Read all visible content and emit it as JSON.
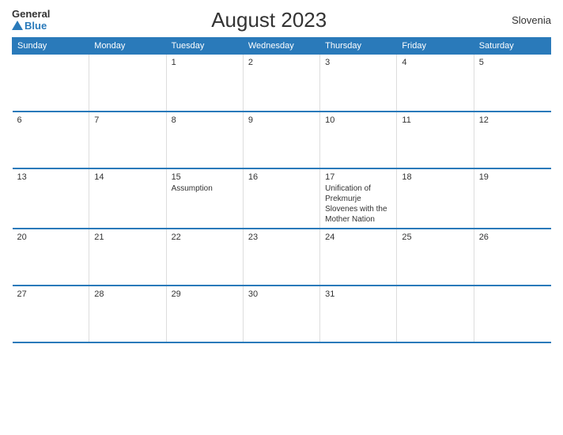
{
  "header": {
    "logo_general": "General",
    "logo_blue": "Blue",
    "title": "August 2023",
    "country": "Slovenia"
  },
  "days": [
    "Sunday",
    "Monday",
    "Tuesday",
    "Wednesday",
    "Thursday",
    "Friday",
    "Saturday"
  ],
  "weeks": [
    [
      {
        "date": "",
        "event": ""
      },
      {
        "date": "",
        "event": ""
      },
      {
        "date": "1",
        "event": ""
      },
      {
        "date": "2",
        "event": ""
      },
      {
        "date": "3",
        "event": ""
      },
      {
        "date": "4",
        "event": ""
      },
      {
        "date": "5",
        "event": ""
      }
    ],
    [
      {
        "date": "6",
        "event": ""
      },
      {
        "date": "7",
        "event": ""
      },
      {
        "date": "8",
        "event": ""
      },
      {
        "date": "9",
        "event": ""
      },
      {
        "date": "10",
        "event": ""
      },
      {
        "date": "11",
        "event": ""
      },
      {
        "date": "12",
        "event": ""
      }
    ],
    [
      {
        "date": "13",
        "event": ""
      },
      {
        "date": "14",
        "event": ""
      },
      {
        "date": "15",
        "event": "Assumption"
      },
      {
        "date": "16",
        "event": ""
      },
      {
        "date": "17",
        "event": "Unification of Prekmurje Slovenes with the Mother Nation"
      },
      {
        "date": "18",
        "event": ""
      },
      {
        "date": "19",
        "event": ""
      }
    ],
    [
      {
        "date": "20",
        "event": ""
      },
      {
        "date": "21",
        "event": ""
      },
      {
        "date": "22",
        "event": ""
      },
      {
        "date": "23",
        "event": ""
      },
      {
        "date": "24",
        "event": ""
      },
      {
        "date": "25",
        "event": ""
      },
      {
        "date": "26",
        "event": ""
      }
    ],
    [
      {
        "date": "27",
        "event": ""
      },
      {
        "date": "28",
        "event": ""
      },
      {
        "date": "29",
        "event": ""
      },
      {
        "date": "30",
        "event": ""
      },
      {
        "date": "31",
        "event": ""
      },
      {
        "date": "",
        "event": ""
      },
      {
        "date": "",
        "event": ""
      }
    ]
  ]
}
